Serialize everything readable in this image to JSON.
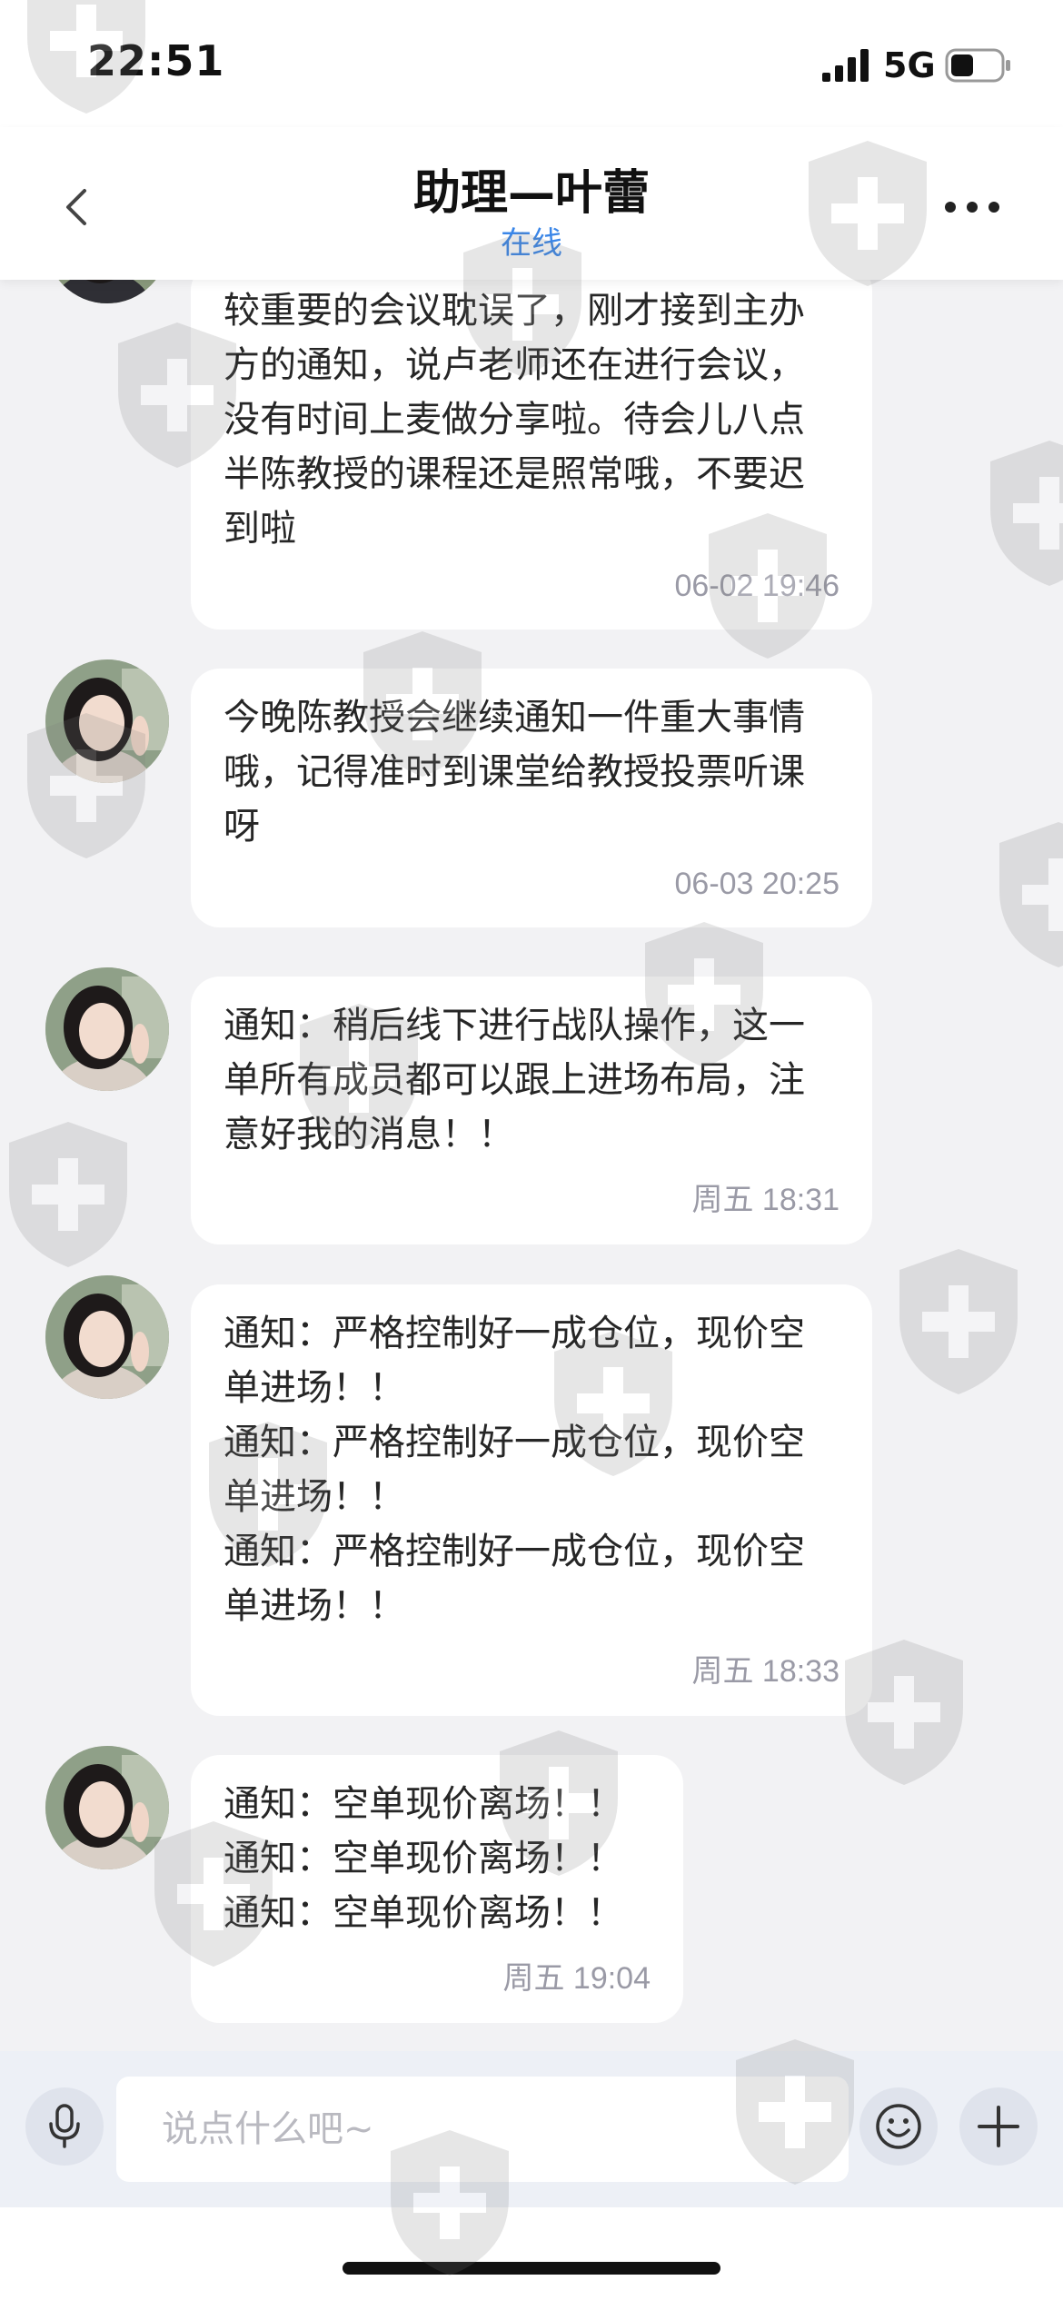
{
  "status_bar": {
    "time": "22:51",
    "network": "5G",
    "signal_icon": "cellular-signal-icon",
    "battery_icon": "battery-icon"
  },
  "header": {
    "title": "助理—叶蕾",
    "status": "在线",
    "back_icon": "chevron-left-icon",
    "more_icon": "more-dots-icon"
  },
  "messages": [
    {
      "text": "较重要的会议耽误了，刚才接到主办方的通知，说卢老师还在进行会议，没有时间上麦做分享啦。待会儿八点半陈教授的课程还是照常哦，不要迟到啦",
      "time": "06-02 19:46"
    },
    {
      "text": "今晚陈教授会继续通知一件重大事情哦，记得准时到课堂给教授投票听课呀",
      "time": "06-03 20:25"
    },
    {
      "text": "通知：稍后线下进行战队操作，这一单所有成员都可以跟上进场布局，注意好我的消息！！",
      "time": "周五 18:31"
    },
    {
      "text": "通知：严格控制好一成仓位，现价空单进场！！\n通知：严格控制好一成仓位，现价空单进场！！\n通知：严格控制好一成仓位，现价空单进场！！",
      "time": "周五 18:33"
    },
    {
      "text": "通知：空单现价离场！！\n通知：空单现价离场！！\n通知：空单现价离场！！",
      "time": "周五 19:04"
    }
  ],
  "input_bar": {
    "placeholder": "说点什么吧~",
    "voice_icon": "microphone-icon",
    "emoji_icon": "smiley-icon",
    "add_icon": "plus-icon"
  },
  "colors": {
    "online_status": "#3a86e8",
    "background": "#f2f2f4",
    "bubble": "#ffffff",
    "timestamp": "#9a9aa6"
  }
}
